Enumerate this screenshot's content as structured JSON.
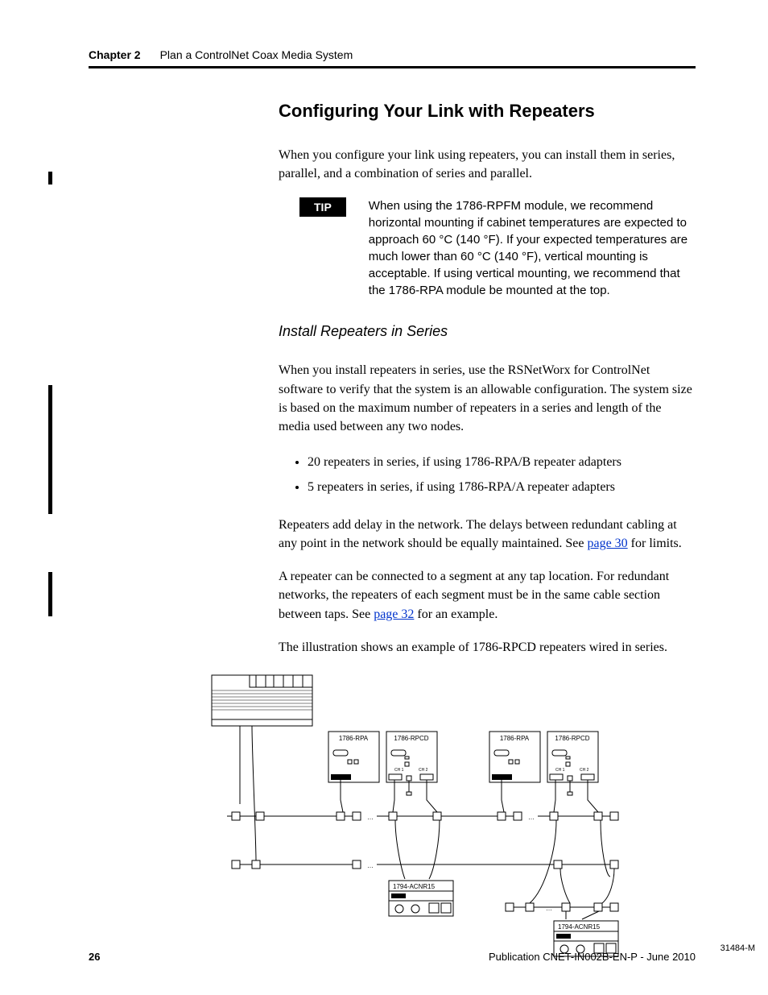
{
  "header": {
    "chapter": "Chapter 2",
    "title": "Plan a ControlNet Coax Media System"
  },
  "h2": "Configuring Your Link with Repeaters",
  "intro": "When you configure your link using repeaters, you can install them in series, parallel, and a combination of series and parallel.",
  "tip": {
    "badge": "TIP",
    "text": "When using the 1786-RPFM module, we recommend horizontal mounting if cabinet temperatures are expected to approach 60 °C (140 °F). If your expected temperatures are much lower than 60 °C (140 °F), vertical mounting is acceptable. If using vertical mounting, we recommend that the 1786-RPA module be mounted at the top."
  },
  "h3": "Install Repeaters in Series",
  "series_intro": "When you install repeaters in series, use the RSNetWorx for ControlNet software to verify that the system is an allowable configuration. The system size is based on the maximum number of repeaters in a series and length of the media used between any two nodes.",
  "bullets": [
    "20 repeaters in series, if using 1786-RPA/B repeater adapters",
    "5 repeaters in series, if using 1786-RPA/A repeater adapters"
  ],
  "delay_before": "Repeaters add delay in the network. The delays between redundant cabling at any point in the network should be equally maintained. See ",
  "delay_link": "page 30",
  "delay_after": " for limits.",
  "redundant_before": "A repeater can be connected to a segment at any tap location. For redundant networks, the repeaters of each segment must be in the same cable section between taps. See ",
  "redundant_link": "page 32",
  "redundant_after": " for an example.",
  "illu": "The illustration shows an example of 1786-RPCD repeaters wired in series.",
  "diagram": {
    "module_rpa": "1786-RPA",
    "module_rpcd": "1786-RPCD",
    "module_acnr": "1794-ACNR15",
    "ch1": "CH 1",
    "ch2": "CH 2",
    "ref": "31484-M"
  },
  "footer": {
    "page": "26",
    "pub": "Publication CNET-IN002B-EN-P - June 2010"
  }
}
